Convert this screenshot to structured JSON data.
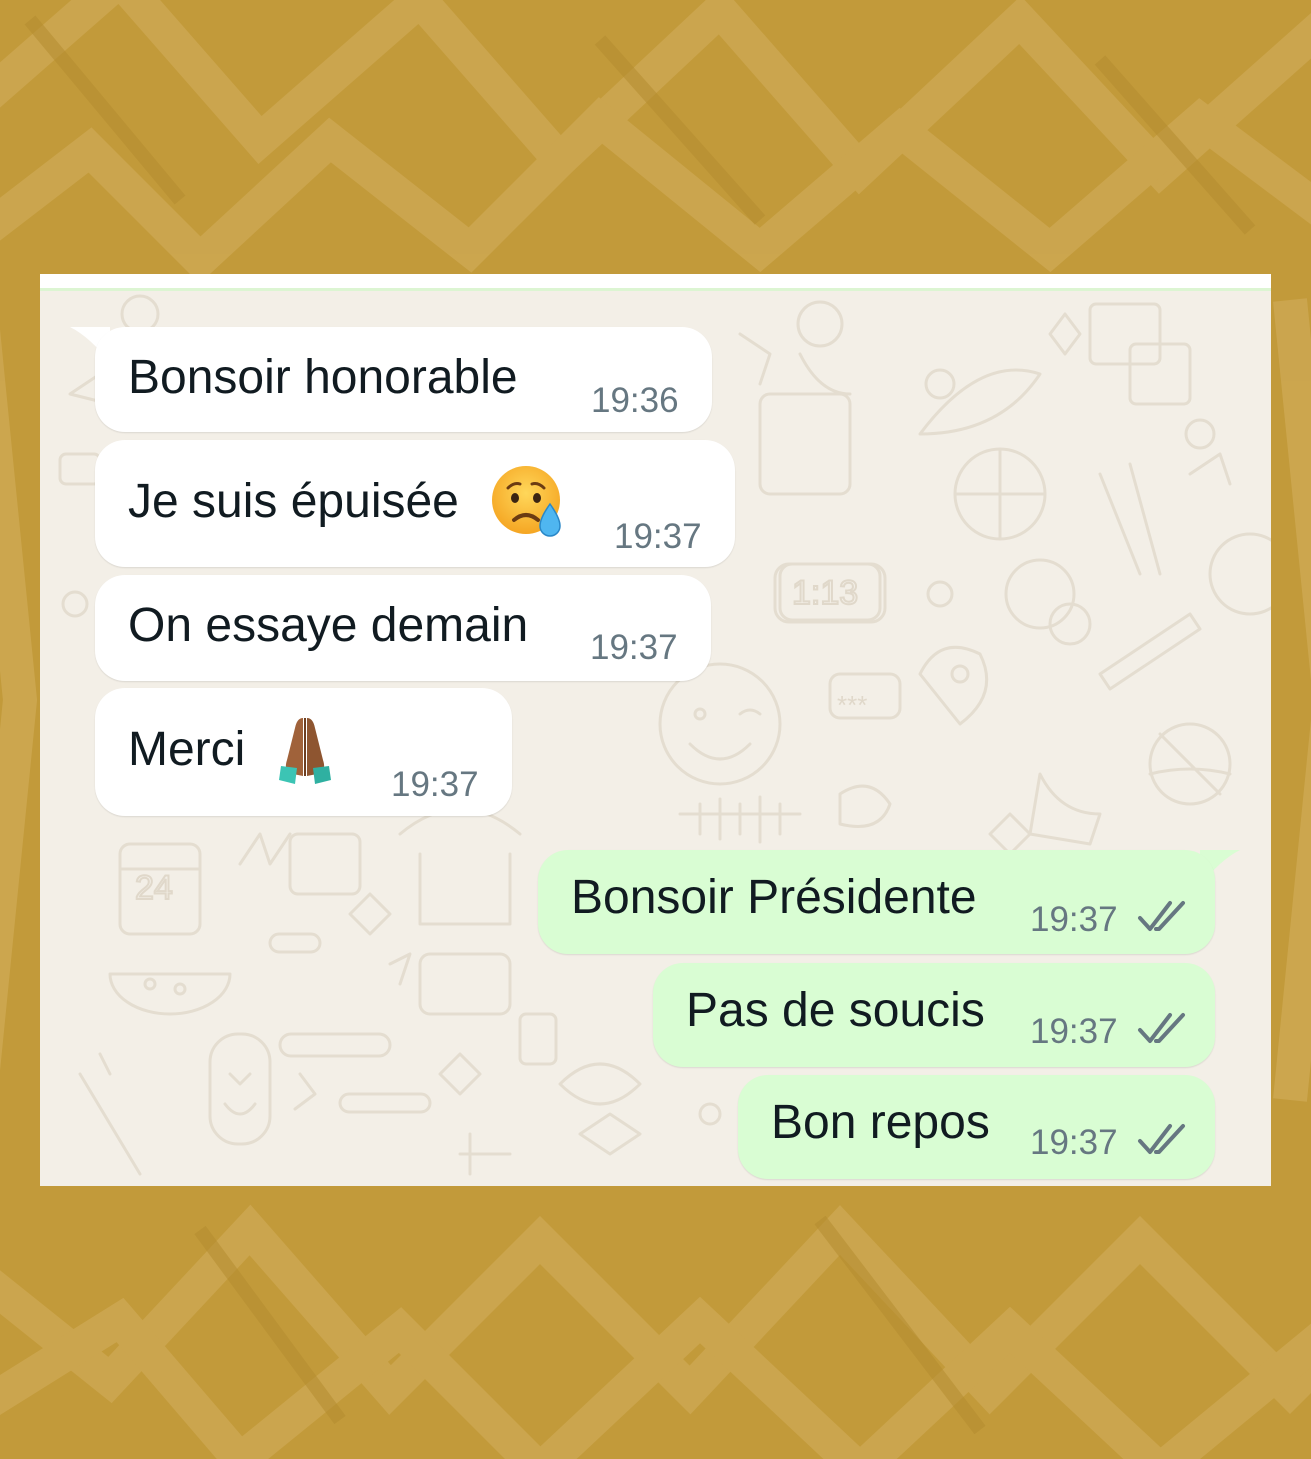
{
  "chat": {
    "incoming_color": "#ffffff",
    "outgoing_color": "#d9fdd3",
    "background_color": "#f3efe7",
    "frame_color": "#c29a3a",
    "messages": [
      {
        "direction": "incoming",
        "text": "Bonsoir honorable",
        "time": "19:36"
      },
      {
        "direction": "incoming",
        "text": "Je suis épuisée",
        "emoji": "sad-relieved-face-emoji",
        "time": "19:37"
      },
      {
        "direction": "incoming",
        "text": "On essaye demain",
        "time": "19:37"
      },
      {
        "direction": "incoming",
        "text": "Merci",
        "emoji": "folded-hands-emoji",
        "time": "19:37"
      },
      {
        "direction": "outgoing",
        "text": "Bonsoir Présidente",
        "time": "19:37",
        "status": "read-double-check"
      },
      {
        "direction": "outgoing",
        "text": "Pas de soucis",
        "time": "19:37",
        "status": "read-double-check"
      },
      {
        "direction": "outgoing",
        "text": "Bon repos",
        "time": "19:37",
        "status": "read-double-check"
      }
    ],
    "wallpaper_clock": "1:13",
    "wallpaper_calendar": "24",
    "wallpaper_password": "***"
  }
}
